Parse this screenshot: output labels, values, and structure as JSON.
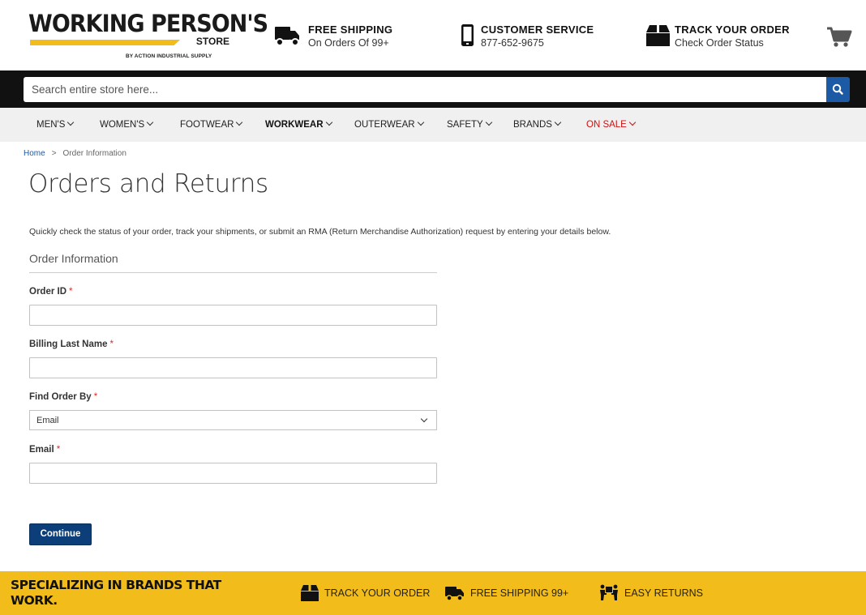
{
  "header": {
    "logo": {
      "name": "WORKING PERSON'S",
      "store": "STORE",
      "sub": "BY ACTION INDUSTRIAL SUPPLY"
    },
    "shipping": {
      "title": "FREE SHIPPING",
      "sub": "On Orders Of 99+"
    },
    "service": {
      "title": "CUSTOMER SERVICE",
      "sub": "877-652-9675"
    },
    "track": {
      "title": "TRACK YOUR ORDER",
      "sub": "Check Order Status"
    }
  },
  "search": {
    "placeholder": "Search entire store here..."
  },
  "nav": {
    "items": [
      {
        "label": "MEN'S"
      },
      {
        "label": "WOMEN'S"
      },
      {
        "label": "FOOTWEAR"
      },
      {
        "label": "WORKWEAR"
      },
      {
        "label": "OUTERWEAR"
      },
      {
        "label": "SAFETY"
      },
      {
        "label": "BRANDS"
      },
      {
        "label": "ON SALE"
      }
    ]
  },
  "breadcrumb": {
    "home": "Home",
    "separator": ">",
    "current": "Order Information"
  },
  "page": {
    "title": "Orders and Returns",
    "intro": "Quickly check the status of your order, track your shipments, or submit an RMA (Return Merchandise Authorization) request by entering your details below.",
    "section_title": "Order Information"
  },
  "form": {
    "required_mark": "*",
    "order_id": {
      "label": "Order ID",
      "value": ""
    },
    "last_name": {
      "label": "Billing Last Name",
      "value": ""
    },
    "find_by": {
      "label": "Find Order By",
      "selected": "Email"
    },
    "email": {
      "label": "Email",
      "value": ""
    },
    "submit_label": "Continue"
  },
  "footer": {
    "tagline": "SPECIALIZING IN BRANDS THAT WORK.",
    "track": "TRACK YOUR ORDER",
    "shipping": "FREE SHIPPING 99+",
    "returns": "EASY RETURNS"
  },
  "colors": {
    "accent_blue": "#1d5aa6",
    "button_navy": "#0c3f79",
    "footer_yellow": "#f2bd1a",
    "sale_red": "#cc1111"
  }
}
